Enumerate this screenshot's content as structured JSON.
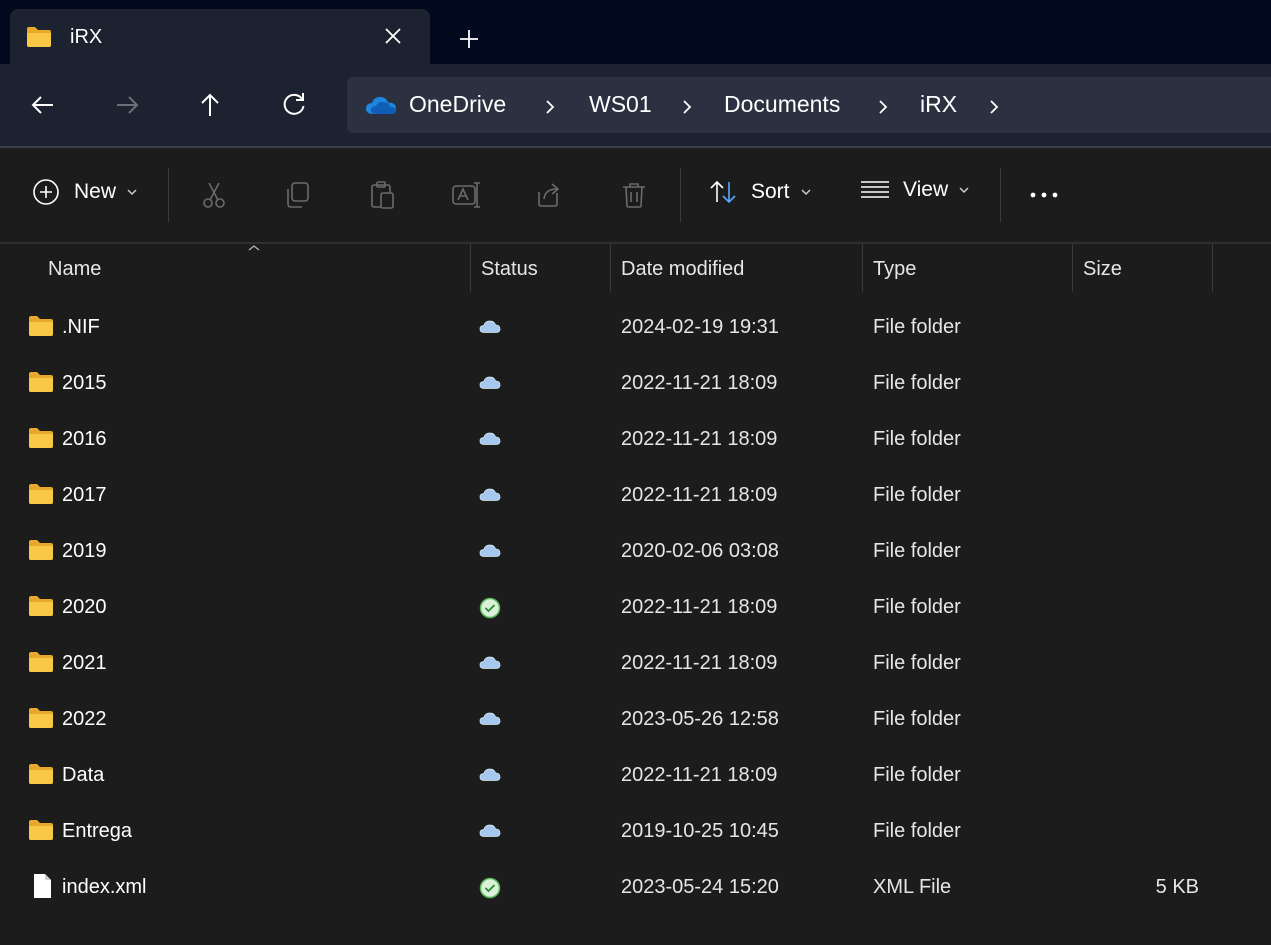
{
  "tab": {
    "title": "iRX"
  },
  "breadcrumb": [
    "OneDrive",
    "WS01",
    "Documents",
    "iRX"
  ],
  "commands": {
    "new_label": "New",
    "sort_label": "Sort",
    "view_label": "View"
  },
  "columns": {
    "name": "Name",
    "status": "Status",
    "date": "Date modified",
    "type": "Type",
    "size": "Size"
  },
  "colors": {
    "folder": "#f8c744",
    "cloud": "#a5c8ee",
    "synced": "#5cb85c",
    "accent_cloud": "#1f86e0"
  },
  "files": [
    {
      "name": ".NIF",
      "status": "cloud",
      "date": "2024-02-19 19:31",
      "type": "File folder",
      "size": "",
      "kind": "folder"
    },
    {
      "name": "2015",
      "status": "cloud",
      "date": "2022-11-21 18:09",
      "type": "File folder",
      "size": "",
      "kind": "folder"
    },
    {
      "name": "2016",
      "status": "cloud",
      "date": "2022-11-21 18:09",
      "type": "File folder",
      "size": "",
      "kind": "folder"
    },
    {
      "name": "2017",
      "status": "cloud",
      "date": "2022-11-21 18:09",
      "type": "File folder",
      "size": "",
      "kind": "folder"
    },
    {
      "name": "2019",
      "status": "cloud",
      "date": "2020-02-06 03:08",
      "type": "File folder",
      "size": "",
      "kind": "folder"
    },
    {
      "name": "2020",
      "status": "synced",
      "date": "2022-11-21 18:09",
      "type": "File folder",
      "size": "",
      "kind": "folder"
    },
    {
      "name": "2021",
      "status": "cloud",
      "date": "2022-11-21 18:09",
      "type": "File folder",
      "size": "",
      "kind": "folder"
    },
    {
      "name": "2022",
      "status": "cloud",
      "date": "2023-05-26 12:58",
      "type": "File folder",
      "size": "",
      "kind": "folder"
    },
    {
      "name": "Data",
      "status": "cloud",
      "date": "2022-11-21 18:09",
      "type": "File folder",
      "size": "",
      "kind": "folder"
    },
    {
      "name": "Entrega",
      "status": "cloud",
      "date": "2019-10-25 10:45",
      "type": "File folder",
      "size": "",
      "kind": "folder"
    },
    {
      "name": "index.xml",
      "status": "synced",
      "date": "2023-05-24 15:20",
      "type": "XML File",
      "size": "5 KB",
      "kind": "file"
    }
  ]
}
